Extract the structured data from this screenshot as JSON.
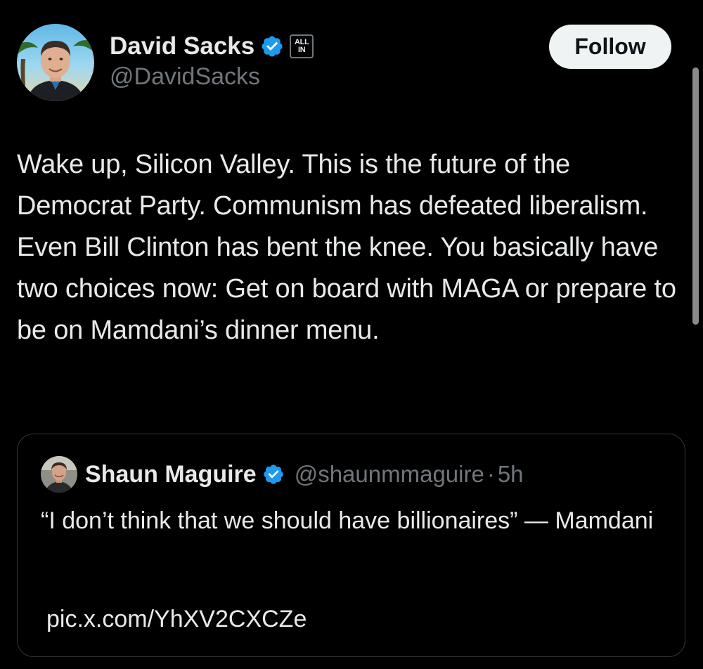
{
  "author": {
    "display_name": "David Sacks",
    "handle": "@DavidSacks",
    "verified_icon": "verified-badge-icon",
    "affiliate_badge": {
      "line1": "ALL",
      "line2": "IN"
    }
  },
  "follow_button": {
    "label": "Follow"
  },
  "tweet": {
    "text": "Wake up, Silicon Valley. This is the future of the Democrat Party. Communism has defeated liberalism. Even Bill Clinton has bent the knee. You basically have two choices now: Get on board with MAGA or prepare to be on Mamdani’s dinner menu."
  },
  "quoted_tweet": {
    "display_name": "Shaun Maguire",
    "handle": "@shaunmmaguire",
    "separator": "·",
    "time": "5h",
    "text": "“I don’t think that we should have billionaires” — Mamdani",
    "link": "pic.x.com/YhXV2CXCZe"
  },
  "colors": {
    "background": "#000000",
    "text_primary": "#e7e9ea",
    "text_secondary": "#71767b",
    "verified_blue": "#1d9bf0",
    "card_border": "#333639",
    "follow_button_bg": "#eff3f4"
  }
}
